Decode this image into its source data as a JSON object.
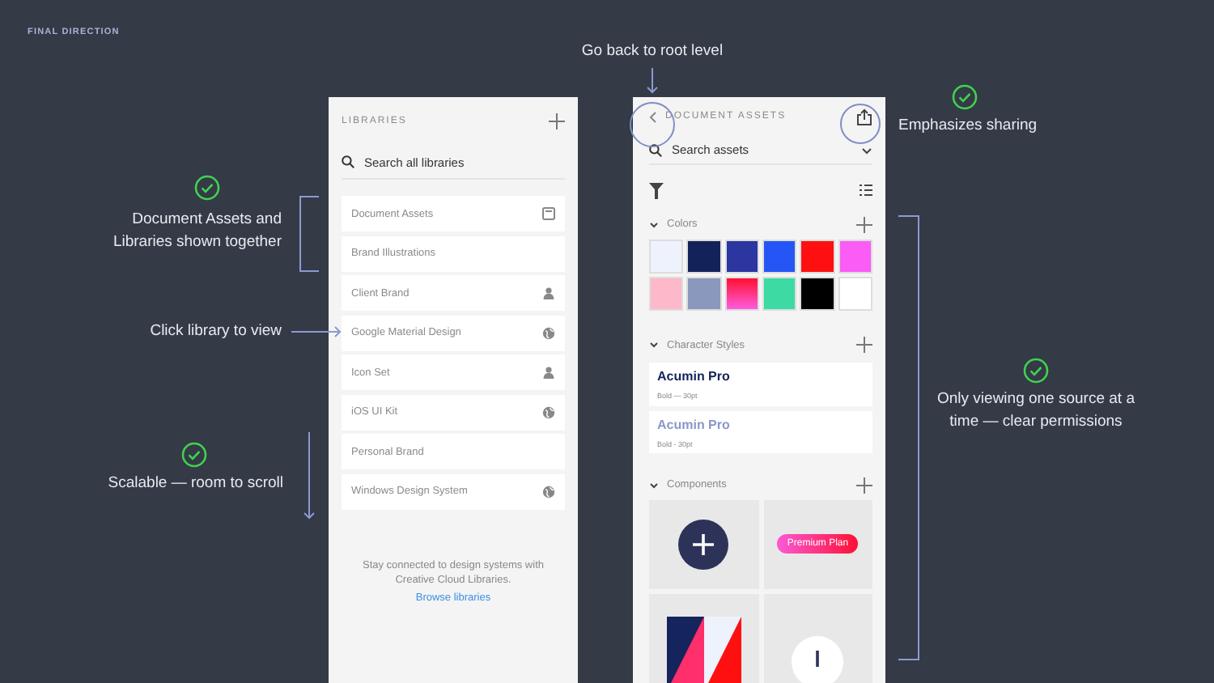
{
  "slide_title": "FINAL DIRECTION",
  "libraries_panel": {
    "title": "LIBRARIES",
    "search": {
      "placeholder": "Search all libraries"
    },
    "items": [
      {
        "name": "Document Assets",
        "kind": "document"
      },
      {
        "name": "Brand Illustrations",
        "kind": "plain"
      },
      {
        "name": "Client Brand",
        "kind": "shared"
      },
      {
        "name": "Google Material Design",
        "kind": "public"
      },
      {
        "name": "Icon Set",
        "kind": "shared"
      },
      {
        "name": "iOS UI Kit",
        "kind": "public"
      },
      {
        "name": "Personal Brand",
        "kind": "plain"
      },
      {
        "name": "Windows Design System",
        "kind": "public"
      }
    ],
    "footer_text": "Stay connected to design systems with Creative Cloud Libraries.",
    "footer_link": "Browse libraries"
  },
  "assets_panel": {
    "title": "DOCUMENT ASSETS",
    "search": {
      "placeholder": "Search assets"
    },
    "colors_section": {
      "title": "Colors",
      "expanded": true,
      "swatches": [
        {
          "color": "#eef2fd"
        },
        {
          "color": "#13235a"
        },
        {
          "color": "#2b36a0"
        },
        {
          "color": "#2556f5"
        },
        {
          "color": "#ff1010"
        },
        {
          "color": "#fa5cf5"
        },
        {
          "color": "#fdb8c9"
        },
        {
          "color": "#8a98bd"
        },
        {
          "kind": "gradient"
        },
        {
          "color": "#3ddba3"
        },
        {
          "color": "#000000"
        },
        {
          "color": "#ffffff"
        }
      ]
    },
    "character_styles_section": {
      "title": "Character Styles",
      "expanded": true,
      "styles": [
        {
          "name": "Acumin Pro",
          "detail": "Bold — 30pt",
          "color": "#13235a"
        },
        {
          "name": "Acumin Pro",
          "detail": "Bold - 30pt",
          "color": "#8a98c8"
        }
      ]
    },
    "components_section": {
      "title": "Components",
      "expanded": true,
      "components": [
        {
          "kind": "add-button"
        },
        {
          "kind": "badge",
          "label": "Premium Plan"
        },
        {
          "kind": "artwork"
        },
        {
          "kind": "round-button"
        }
      ]
    }
  },
  "notes": {
    "back": "Go back to root level",
    "sharing": "Emphasizes sharing",
    "together": "Document Assets and Libraries shown together",
    "click": "Click library to view",
    "scalable": "Scalable — room to scroll",
    "one_source": "Only viewing one source at a time — clear permissions"
  }
}
